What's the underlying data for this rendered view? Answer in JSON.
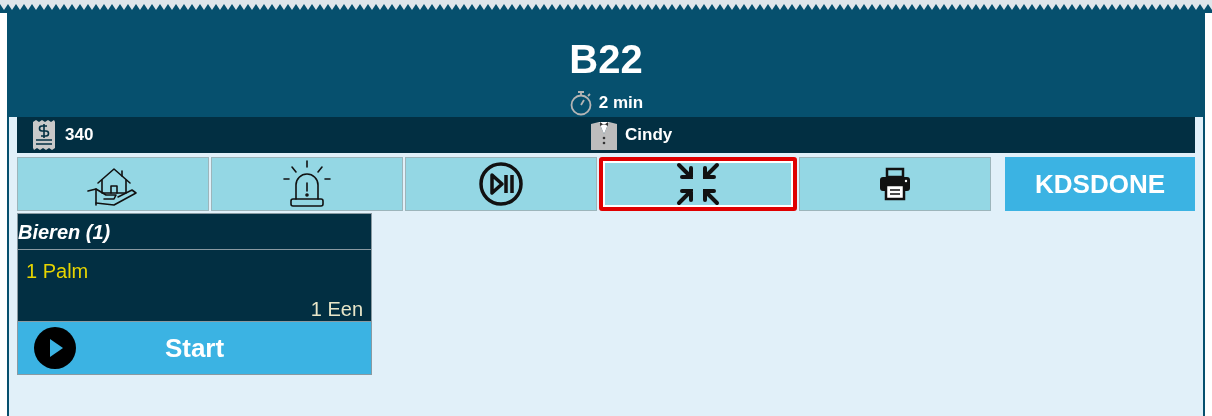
{
  "header": {
    "title": "B22",
    "timer": "2 min"
  },
  "info_bar": {
    "check_number": "340",
    "waiter": "Cindy"
  },
  "toolbar": [
    {
      "kind": "home",
      "highlighted": false
    },
    {
      "kind": "alarm",
      "highlighted": false
    },
    {
      "kind": "playpause",
      "highlighted": false
    },
    {
      "kind": "compress",
      "highlighted": true
    },
    {
      "kind": "print",
      "highlighted": false
    },
    {
      "kind": "text",
      "label": "KDSDONE",
      "highlighted": false
    }
  ],
  "order_card": {
    "category": "Bieren (1)",
    "items": [
      {
        "name": "1 Palm",
        "detail": "1 Een"
      }
    ],
    "action": "Start"
  }
}
